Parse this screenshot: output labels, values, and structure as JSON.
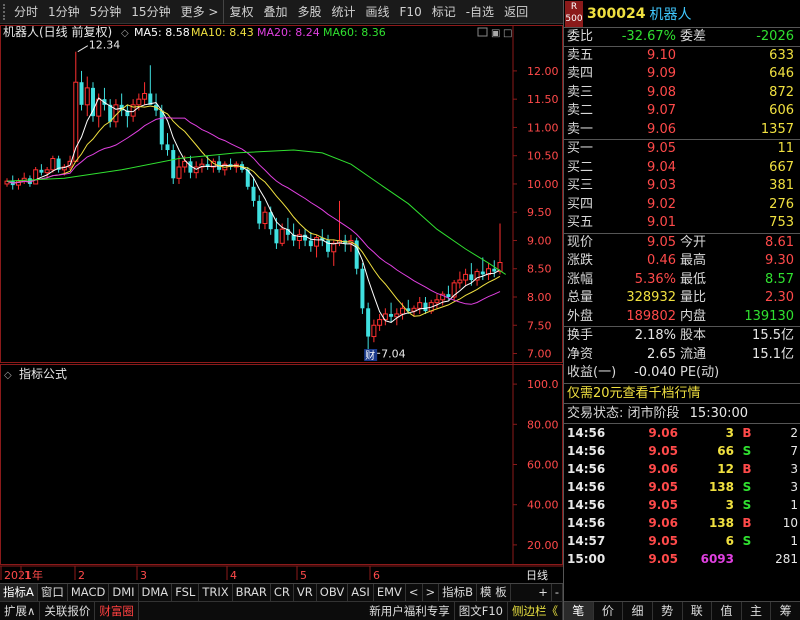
{
  "toolbar": {
    "items": [
      "分时",
      "1分钟",
      "5分钟",
      "15分钟",
      "更多 >",
      "复权",
      "叠加",
      "多股",
      "统计",
      "画线",
      "F10",
      "标记",
      "-自选",
      "返回"
    ]
  },
  "chart_main": {
    "title": "机器人(日线 前复权)",
    "ma_labels": [
      {
        "text": "MA5: 8.58",
        "color": "#ffffff"
      },
      {
        "text": "MA10: 8.43",
        "color": "#f0e040"
      },
      {
        "text": "MA20: 8.24",
        "color": "#e040e0"
      },
      {
        "text": "MA60: 8.36",
        "color": "#30e030"
      }
    ],
    "high_label": "12.34",
    "low_label": "7.04",
    "event_badge": "财"
  },
  "chart_indicator": {
    "title": "指标公式"
  },
  "chart_data": [
    {
      "type": "candlestick",
      "ylim": [
        6.85,
        12.6
      ],
      "yticks": [
        "12.00",
        "11.50",
        "11.00",
        "10.50",
        "10.00",
        "9.50",
        "9.00",
        "8.50",
        "8.00",
        "7.50",
        "7.00"
      ],
      "ytick_values": [
        12.0,
        11.5,
        11.0,
        10.5,
        10.0,
        9.5,
        9.0,
        8.5,
        8.0,
        7.5,
        7.0
      ],
      "xaxis_labels": [
        "2021年",
        "1",
        "2",
        "3",
        "4",
        "5",
        "6",
        "日线"
      ],
      "xaxis_positions": [
        0,
        20,
        74,
        136,
        226,
        296,
        369,
        462
      ],
      "candles": [
        [
          10.0,
          10.1,
          9.95,
          10.05
        ],
        [
          10.05,
          10.15,
          9.9,
          9.98
        ],
        [
          9.98,
          10.1,
          9.9,
          10.05
        ],
        [
          10.05,
          10.2,
          10.0,
          10.1
        ],
        [
          10.1,
          10.15,
          9.95,
          10.0
        ],
        [
          10.0,
          10.3,
          10.0,
          10.25
        ],
        [
          10.25,
          10.35,
          10.15,
          10.2
        ],
        [
          10.2,
          10.3,
          10.1,
          10.25
        ],
        [
          10.25,
          10.5,
          10.2,
          10.45
        ],
        [
          10.45,
          10.5,
          10.2,
          10.25
        ],
        [
          10.25,
          10.35,
          10.15,
          10.3
        ],
        [
          10.3,
          10.5,
          10.25,
          10.4
        ],
        [
          10.4,
          12.34,
          10.4,
          11.8
        ],
        [
          11.8,
          12.0,
          11.3,
          11.4
        ],
        [
          11.4,
          11.9,
          11.2,
          11.7
        ],
        [
          11.7,
          11.8,
          11.1,
          11.2
        ],
        [
          11.2,
          11.6,
          11.0,
          11.5
        ],
        [
          11.5,
          11.7,
          11.3,
          11.4
        ],
        [
          11.4,
          11.5,
          11.0,
          11.1
        ],
        [
          11.1,
          11.5,
          11.0,
          11.4
        ],
        [
          11.4,
          11.6,
          11.2,
          11.3
        ],
        [
          11.3,
          11.4,
          11.0,
          11.2
        ],
        [
          11.2,
          11.5,
          11.1,
          11.4
        ],
        [
          11.4,
          11.6,
          11.3,
          11.5
        ],
        [
          11.5,
          11.8,
          11.4,
          11.6
        ],
        [
          11.6,
          12.1,
          11.5,
          11.4
        ],
        [
          11.4,
          11.6,
          11.2,
          11.3
        ],
        [
          11.3,
          11.4,
          10.6,
          10.7
        ],
        [
          10.7,
          10.9,
          10.5,
          10.6
        ],
        [
          10.6,
          10.7,
          10.0,
          10.1
        ],
        [
          10.1,
          10.5,
          10.0,
          10.3
        ],
        [
          10.3,
          10.5,
          10.2,
          10.4
        ],
        [
          10.4,
          10.5,
          10.1,
          10.2
        ],
        [
          10.2,
          10.4,
          10.1,
          10.3
        ],
        [
          10.3,
          10.45,
          10.2,
          10.35
        ],
        [
          10.35,
          10.5,
          10.25,
          10.3
        ],
        [
          10.3,
          10.45,
          10.2,
          10.4
        ],
        [
          10.4,
          10.5,
          10.2,
          10.25
        ],
        [
          10.25,
          10.4,
          10.15,
          10.35
        ],
        [
          10.35,
          10.45,
          10.25,
          10.3
        ],
        [
          10.3,
          10.4,
          10.2,
          10.35
        ],
        [
          10.35,
          10.4,
          10.2,
          10.25
        ],
        [
          10.25,
          10.3,
          9.9,
          9.95
        ],
        [
          9.95,
          10.1,
          9.6,
          9.7
        ],
        [
          9.7,
          9.8,
          9.2,
          9.3
        ],
        [
          9.3,
          9.6,
          9.2,
          9.5
        ],
        [
          9.5,
          9.6,
          9.1,
          9.2
        ],
        [
          9.2,
          9.4,
          8.85,
          8.95
        ],
        [
          8.95,
          9.3,
          8.9,
          9.2
        ],
        [
          9.2,
          9.4,
          9.0,
          9.1
        ],
        [
          9.1,
          9.3,
          8.9,
          9.0
        ],
        [
          9.0,
          9.2,
          8.85,
          9.1
        ],
        [
          9.1,
          9.2,
          8.9,
          9.0
        ],
        [
          9.0,
          9.15,
          8.8,
          8.9
        ],
        [
          8.9,
          9.1,
          8.7,
          9.05
        ],
        [
          9.05,
          9.2,
          8.9,
          9.0
        ],
        [
          9.0,
          9.1,
          8.7,
          8.8
        ],
        [
          8.8,
          9.0,
          8.55,
          8.95
        ],
        [
          8.95,
          9.7,
          8.9,
          9.0
        ],
        [
          9.0,
          9.1,
          8.8,
          8.95
        ],
        [
          8.95,
          9.1,
          8.8,
          9.0
        ],
        [
          9.0,
          9.05,
          8.4,
          8.5
        ],
        [
          8.5,
          8.6,
          7.7,
          7.8
        ],
        [
          7.8,
          7.9,
          7.04,
          7.3
        ],
        [
          7.3,
          7.6,
          7.2,
          7.5
        ],
        [
          7.5,
          7.7,
          7.4,
          7.6
        ],
        [
          7.6,
          7.8,
          7.5,
          7.7
        ],
        [
          7.7,
          7.9,
          7.55,
          7.65
        ],
        [
          7.65,
          7.8,
          7.5,
          7.7
        ],
        [
          7.7,
          7.9,
          7.6,
          7.8
        ],
        [
          7.8,
          7.95,
          7.7,
          7.75
        ],
        [
          7.75,
          7.85,
          7.65,
          7.8
        ],
        [
          7.8,
          8.0,
          7.7,
          7.9
        ],
        [
          7.9,
          8.0,
          7.7,
          7.75
        ],
        [
          7.75,
          7.95,
          7.7,
          7.9
        ],
        [
          7.9,
          8.05,
          7.8,
          7.95
        ],
        [
          7.95,
          8.1,
          7.85,
          8.05
        ],
        [
          8.05,
          8.2,
          7.95,
          8.0
        ],
        [
          8.0,
          8.3,
          7.95,
          8.25
        ],
        [
          8.25,
          8.45,
          8.15,
          8.3
        ],
        [
          8.3,
          8.5,
          8.2,
          8.4
        ],
        [
          8.4,
          8.6,
          8.2,
          8.3
        ],
        [
          8.3,
          8.5,
          8.2,
          8.45
        ],
        [
          8.45,
          8.7,
          8.3,
          8.4
        ],
        [
          8.4,
          8.6,
          8.3,
          8.5
        ],
        [
          8.5,
          8.65,
          8.35,
          8.45
        ],
        [
          8.45,
          9.3,
          8.4,
          8.61
        ]
      ],
      "ma60": [
        [
          0,
          10.05
        ],
        [
          10,
          10.1
        ],
        [
          20,
          10.25
        ],
        [
          30,
          10.45
        ],
        [
          40,
          10.55
        ],
        [
          50,
          10.6
        ],
        [
          55,
          10.55
        ],
        [
          60,
          10.35
        ],
        [
          65,
          10.0
        ],
        [
          70,
          9.65
        ],
        [
          75,
          9.2
        ],
        [
          80,
          8.85
        ],
        [
          84,
          8.6
        ],
        [
          87,
          8.4
        ]
      ]
    },
    {
      "type": "indicator",
      "ylim": [
        10,
        110
      ],
      "yticks": [
        "100.0",
        "80.00",
        "60.00",
        "40.00",
        "20.00"
      ],
      "ytick_values": [
        100,
        80,
        60,
        40,
        20
      ]
    }
  ],
  "tabs_row1": [
    "指标A",
    "窗口",
    "MACD",
    "DMI",
    "DMA",
    "FSL",
    "TRIX",
    "BRAR",
    "CR",
    "VR",
    "OBV",
    "ASI",
    "EMV",
    "<",
    ">",
    "指标B",
    "模 板",
    "+",
    "-"
  ],
  "tabs_row2": {
    "left": [
      "扩展∧",
      "关联报价",
      "财富圈"
    ],
    "right": [
      "新用户福利专享",
      "图文F10",
      "侧边栏《"
    ]
  },
  "quote": {
    "badge_top": "R",
    "badge_bottom": "500",
    "code": "300024",
    "name": "机器人",
    "webi_label": "委比",
    "webi_value": "-32.67%",
    "weicha_label": "委差",
    "weicha_value": "-2026",
    "asks": [
      {
        "label": "卖五",
        "price": "9.10",
        "vol": "633"
      },
      {
        "label": "卖四",
        "price": "9.09",
        "vol": "646"
      },
      {
        "label": "卖三",
        "price": "9.08",
        "vol": "872"
      },
      {
        "label": "卖二",
        "price": "9.07",
        "vol": "606"
      },
      {
        "label": "卖一",
        "price": "9.06",
        "vol": "1357"
      }
    ],
    "bids": [
      {
        "label": "买一",
        "price": "9.05",
        "vol": "11"
      },
      {
        "label": "买二",
        "price": "9.04",
        "vol": "667"
      },
      {
        "label": "买三",
        "price": "9.03",
        "vol": "381"
      },
      {
        "label": "买四",
        "price": "9.02",
        "vol": "276"
      },
      {
        "label": "买五",
        "price": "9.01",
        "vol": "753"
      }
    ],
    "stats": [
      {
        "l1": "现价",
        "v1": "9.05",
        "c1": "red",
        "l2": "今开",
        "v2": "8.61",
        "c2": "red"
      },
      {
        "l1": "涨跌",
        "v1": "0.46",
        "c1": "red",
        "l2": "最高",
        "v2": "9.30",
        "c2": "red"
      },
      {
        "l1": "涨幅",
        "v1": "5.36%",
        "c1": "red",
        "l2": "最低",
        "v2": "8.57",
        "c2": "green"
      },
      {
        "l1": "总量",
        "v1": "328932",
        "c1": "yellow",
        "l2": "量比",
        "v2": "2.30",
        "c2": "red"
      },
      {
        "l1": "外盘",
        "v1": "189802",
        "c1": "red",
        "l2": "内盘",
        "v2": "139130",
        "c2": "green"
      }
    ],
    "fin": [
      {
        "l1": "换手",
        "v1": "2.18%",
        "l2": "股本",
        "v2": "15.5亿"
      },
      {
        "l1": "净资",
        "v1": "2.65",
        "l2": "流通",
        "v2": "15.1亿"
      },
      {
        "l1": "收益(一)",
        "v1": "-0.040",
        "l2": "PE(动)",
        "v2": ""
      }
    ],
    "ad_text": "仅需20元查看千档行情",
    "status_label": "交易状态: 闭市阶段",
    "status_time": "15:30:00",
    "ticks": [
      {
        "t": "14:56",
        "p": "9.06",
        "v": "3",
        "vc": "yellow",
        "bs": "B",
        "bsc": "red",
        "c": "2"
      },
      {
        "t": "14:56",
        "p": "9.05",
        "v": "66",
        "vc": "yellow",
        "bs": "S",
        "bsc": "green",
        "c": "7"
      },
      {
        "t": "14:56",
        "p": "9.06",
        "v": "12",
        "vc": "yellow",
        "bs": "B",
        "bsc": "red",
        "c": "3"
      },
      {
        "t": "14:56",
        "p": "9.05",
        "v": "138",
        "vc": "yellow",
        "bs": "S",
        "bsc": "green",
        "c": "3"
      },
      {
        "t": "14:56",
        "p": "9.05",
        "v": "3",
        "vc": "yellow",
        "bs": "S",
        "bsc": "green",
        "c": "1"
      },
      {
        "t": "14:56",
        "p": "9.06",
        "v": "138",
        "vc": "yellow",
        "bs": "B",
        "bsc": "red",
        "c": "10"
      },
      {
        "t": "14:57",
        "p": "9.05",
        "v": "6",
        "vc": "yellow",
        "bs": "S",
        "bsc": "green",
        "c": "1"
      },
      {
        "t": "15:00",
        "p": "9.05",
        "v": "6093",
        "vc": "magenta",
        "bs": "",
        "bsc": "white",
        "c": "281"
      }
    ],
    "tabs": [
      "笔",
      "价",
      "细",
      "势",
      "联",
      "值",
      "主",
      "筹"
    ]
  }
}
